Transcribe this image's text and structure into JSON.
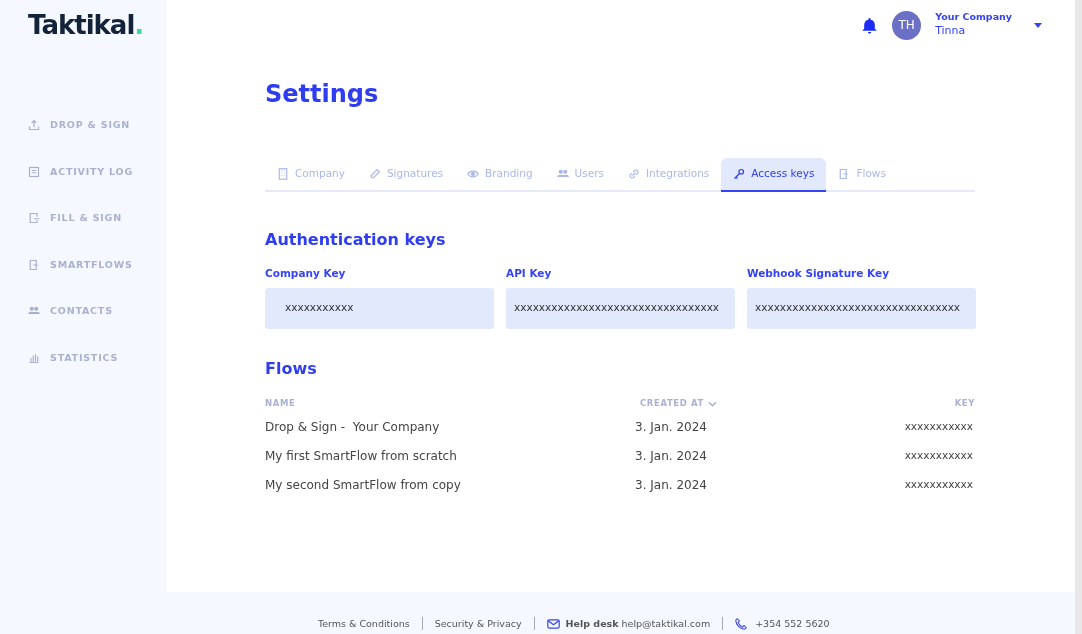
{
  "logo": {
    "text": "Taktikal",
    "dot": "."
  },
  "sidebar": {
    "items": [
      {
        "label": "DROP & SIGN",
        "selected": false
      },
      {
        "label": "ACTIVITY LOG",
        "selected": false
      },
      {
        "label": "FILL & SIGN",
        "selected": false
      },
      {
        "label": "SMARTFLOWS",
        "selected": false
      },
      {
        "label": "CONTACTS",
        "selected": false
      },
      {
        "label": "STATISTICS",
        "selected": false
      }
    ]
  },
  "header": {
    "avatar": "TH",
    "company": "Your Company",
    "user": "Tinna"
  },
  "title": "Settings",
  "tabs": [
    {
      "label": "Company",
      "selected": false
    },
    {
      "label": "Signatures",
      "selected": false
    },
    {
      "label": "Branding",
      "selected": false
    },
    {
      "label": "Users",
      "selected": false
    },
    {
      "label": "Integrations",
      "selected": false
    },
    {
      "label": "Access keys",
      "selected": true
    },
    {
      "label": "Flows",
      "selected": false
    }
  ],
  "auth": {
    "heading": "Authentication keys",
    "fields": [
      {
        "label": "Company Key",
        "value": "xxxxxxxxxxx"
      },
      {
        "label": "API Key",
        "value": "xxxxxxxxxxxxxxxxxxxxxxxxxxxxxxxxx"
      },
      {
        "label": "Webhook Signature Key",
        "value": "xxxxxxxxxxxxxxxxxxxxxxxxxxxxxxxxx"
      }
    ]
  },
  "flows": {
    "heading": "Flows",
    "columns": [
      "NAME",
      "CREATED AT",
      "KEY"
    ],
    "rows": [
      [
        "Drop & Sign -  Your Company",
        "3. Jan. 2024",
        "xxxxxxxxxxx"
      ],
      [
        "My first SmartFlow from scratch",
        "3. Jan. 2024",
        "xxxxxxxxxxx"
      ],
      [
        "My second SmartFlow from copy",
        "3. Jan. 2024",
        "xxxxxxxxxxx"
      ]
    ]
  },
  "footer": {
    "terms": "Terms & Conditions",
    "privacy": "Security & Privacy",
    "help": "**Help desk** help@taktikal.com",
    "phone": "+354 552 5620"
  }
}
